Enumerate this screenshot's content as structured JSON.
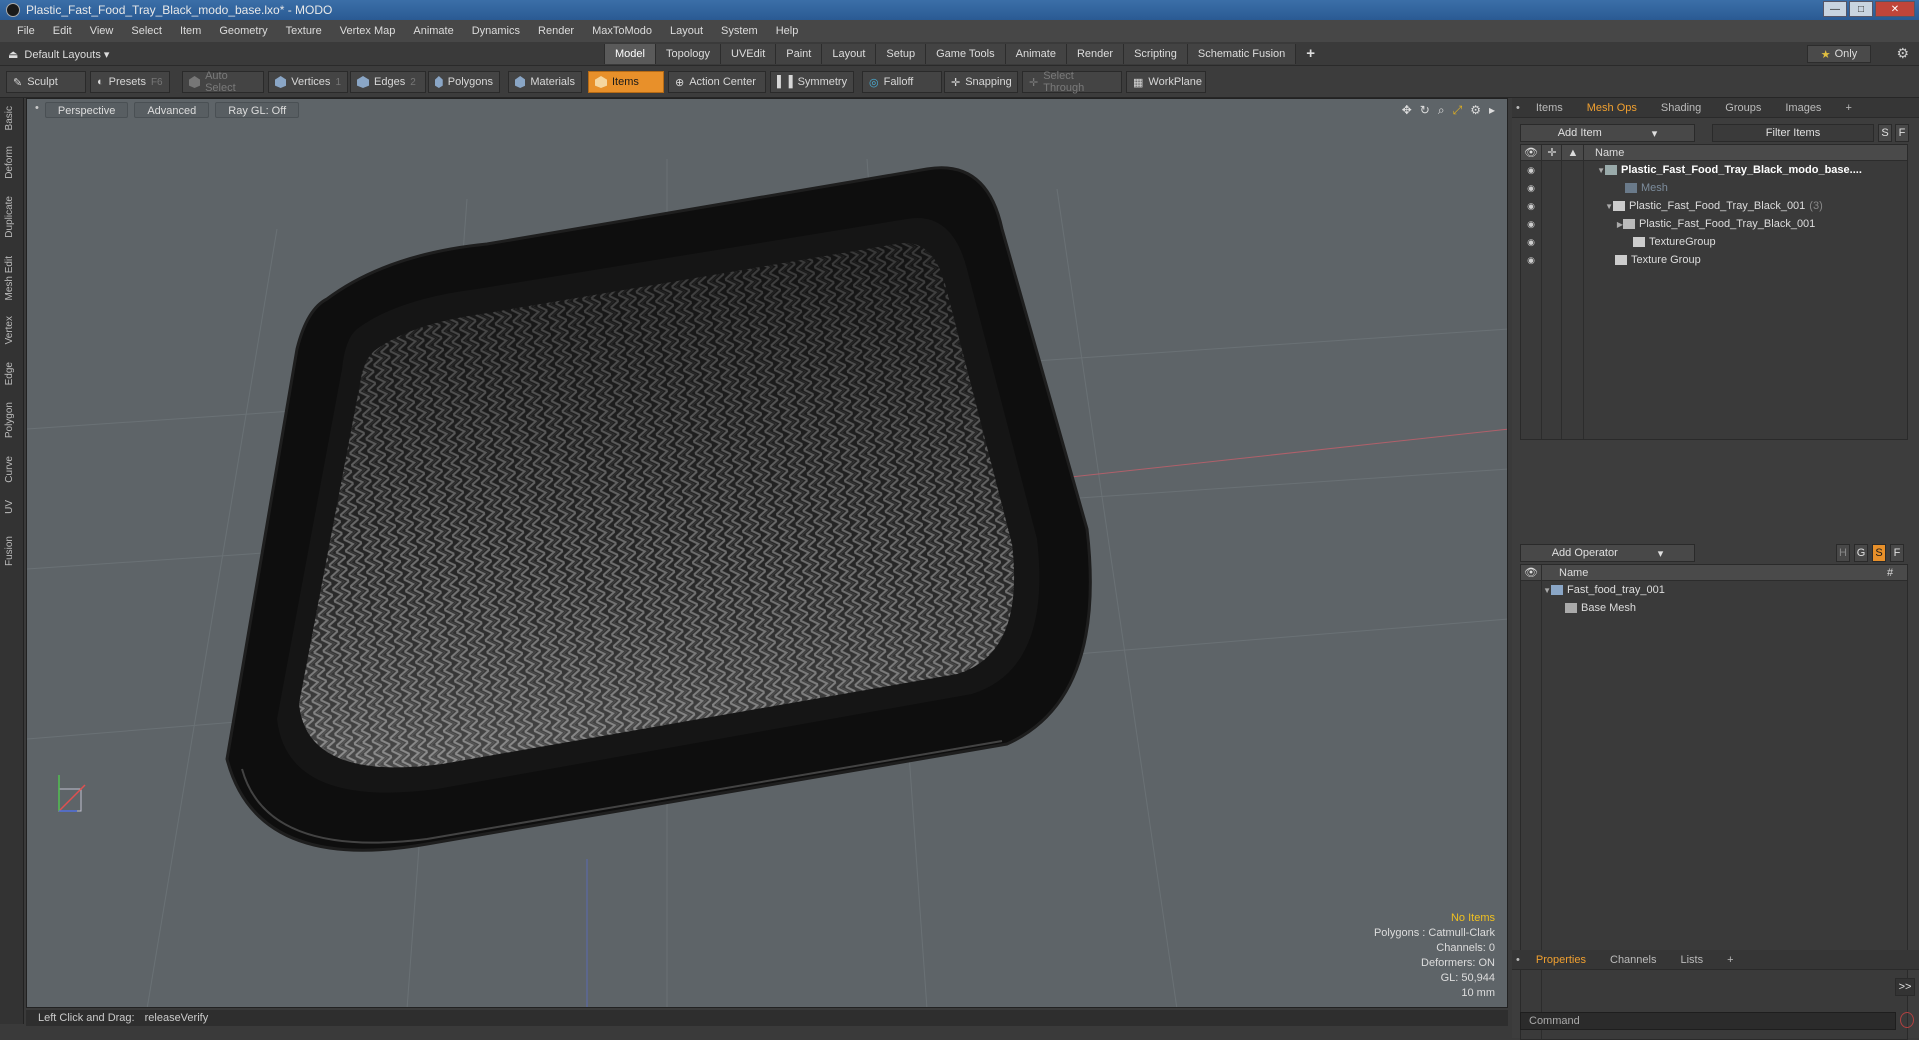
{
  "window": {
    "title": "Plastic_Fast_Food_Tray_Black_modo_base.lxo* - MODO",
    "minimize": "—",
    "maximize": "□",
    "close": "✕"
  },
  "menu": [
    "File",
    "Edit",
    "View",
    "Select",
    "Item",
    "Geometry",
    "Texture",
    "Vertex Map",
    "Animate",
    "Dynamics",
    "Render",
    "MaxToModo",
    "Layout",
    "System",
    "Help"
  ],
  "modebar": {
    "layouts_label": "Default Layouts ▾",
    "tabs": [
      "Model",
      "Topology",
      "UVEdit",
      "Paint",
      "Layout",
      "Setup",
      "Game Tools",
      "Animate",
      "Render",
      "Scripting",
      "Schematic Fusion",
      "+"
    ],
    "active_tab": "Model",
    "only_label": "Only",
    "star": "★"
  },
  "toolbar": {
    "sculpt": "Sculpt",
    "presets": "Presets",
    "presets_key": "F6",
    "auto_select": "Auto Select",
    "vertices": "Vertices",
    "vertices_key": "1",
    "edges": "Edges",
    "edges_key": "2",
    "polygons": "Polygons",
    "materials": "Materials",
    "items": "Items",
    "action_center": "Action Center",
    "symmetry": "Symmetry",
    "falloff": "Falloff",
    "snapping": "Snapping",
    "select_through": "Select Through",
    "workplane": "WorkPlane"
  },
  "left_strip": [
    "Basic",
    "Deform",
    "Duplicate",
    "Mesh Edit",
    "Vertex",
    "Edge",
    "Polygon",
    "Curve",
    "UV",
    "Fusion"
  ],
  "viewport": {
    "perspective": "Perspective",
    "advanced": "Advanced",
    "raygl": "Ray GL: Off",
    "stats": {
      "items": "No Items",
      "polygons": "Polygons : Catmull-Clark",
      "channels": "Channels: 0",
      "deformers": "Deformers: ON",
      "gl": "GL: 50,944",
      "scale": "10 mm"
    }
  },
  "statusbar": {
    "label": "Left Click and Drag:",
    "value": "releaseVerify"
  },
  "items_panel": {
    "tabs": [
      "Items",
      "Mesh Ops",
      "Shading",
      "Groups",
      "Images",
      "+"
    ],
    "active_tab": "Mesh Ops",
    "add_item": "Add Item",
    "filter": "Filter Items",
    "s_btn": "S",
    "f_btn": "F",
    "name_header": "Name",
    "rows": [
      {
        "label": "Plastic_Fast_Food_Tray_Black_modo_base....",
        "count": ""
      },
      {
        "label": "Mesh",
        "count": ""
      },
      {
        "label": "Plastic_Fast_Food_Tray_Black_001",
        "count": "(3)"
      },
      {
        "label": "Plastic_Fast_Food_Tray_Black_001",
        "count": ""
      },
      {
        "label": "TextureGroup",
        "count": ""
      },
      {
        "label": "Texture Group",
        "count": ""
      }
    ]
  },
  "meshops_panel": {
    "add_operator": "Add Operator",
    "btns": [
      "H",
      "G",
      "S",
      "F"
    ],
    "name_header": "Name",
    "hash": "#",
    "rows": [
      {
        "label": "Fast_food_tray_001"
      },
      {
        "label": "Base Mesh"
      }
    ]
  },
  "props_panel": {
    "tabs": [
      "Properties",
      "Channels",
      "Lists",
      "+"
    ],
    "active_tab": "Properties",
    "more": ">>",
    "command_placeholder": "Command"
  }
}
